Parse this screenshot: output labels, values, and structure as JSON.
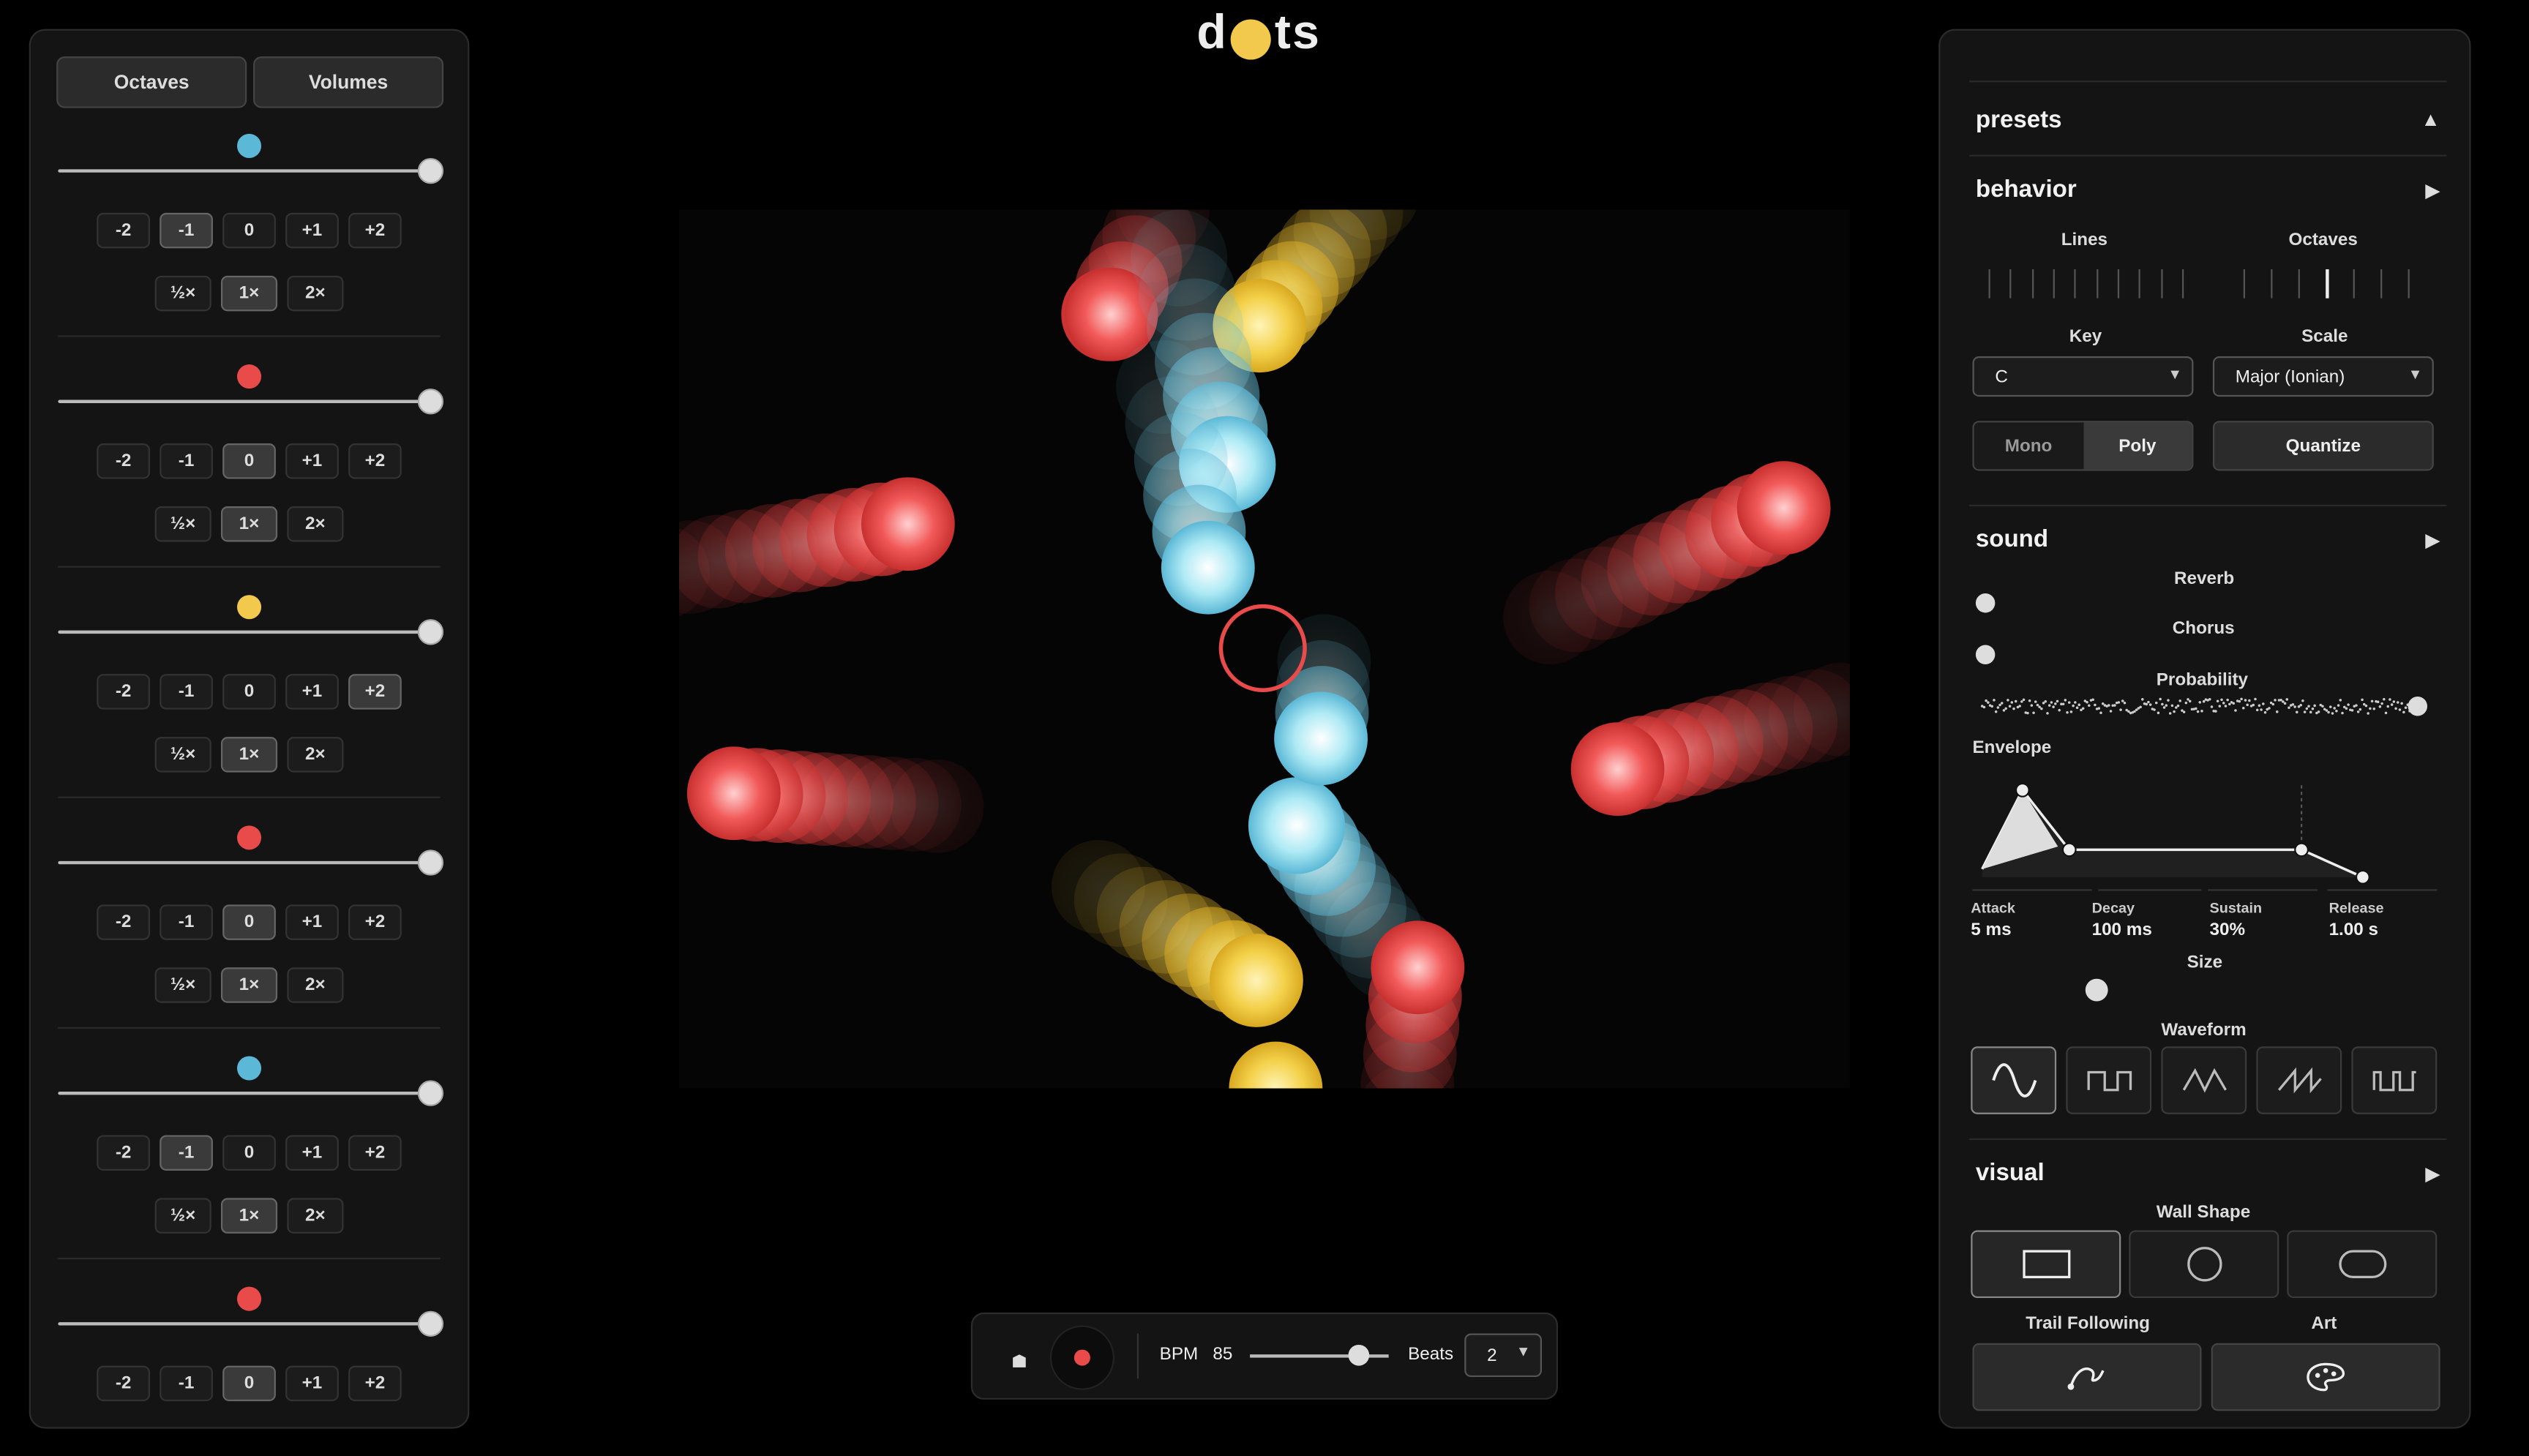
{
  "app": {
    "logo_left": "d",
    "logo_right": "ts",
    "logo_dot_color": "#f2c94c"
  },
  "left_panel": {
    "tabs": [
      "Octaves",
      "Volumes"
    ],
    "octave_buttons": [
      "-2",
      "-1",
      "0",
      "+1",
      "+2"
    ],
    "speed_buttons": [
      "½×",
      "1×",
      "2×"
    ],
    "lines": [
      {
        "color": "#5bb8d6",
        "volume": 1.0,
        "active_octave": "-1",
        "active_speed": "1×"
      },
      {
        "color": "#e94b4b",
        "volume": 1.0,
        "active_octave": "0",
        "active_speed": "1×"
      },
      {
        "color": "#f2c94c",
        "volume": 1.0,
        "active_octave": "+2",
        "active_speed": "1×"
      },
      {
        "color": "#e94b4b",
        "volume": 1.0,
        "active_octave": "0",
        "active_speed": "1×"
      },
      {
        "color": "#5bb8d6",
        "volume": 1.0,
        "active_octave": "-1",
        "active_speed": "1×"
      },
      {
        "color": "#e94b4b",
        "volume": 1.0,
        "active_octave": "0",
        "active_speed": null
      }
    ]
  },
  "transport": {
    "stop_icon": "stop-icon",
    "record_icon": "record-icon",
    "record_color": "#e94b4b",
    "bpm_label": "BPM",
    "bpm_value": "85",
    "bpm_slider_fraction": 0.78,
    "beats_label": "Beats",
    "beats_value": "2"
  },
  "right_panel": {
    "presets": {
      "title": "presets",
      "arrow": "▲"
    },
    "behavior": {
      "title": "behavior",
      "arrow": "▶",
      "lines_label": "Lines",
      "octaves_label": "Octaves",
      "key_label": "Key",
      "key_value": "C",
      "scale_label": "Scale",
      "scale_value": "Major (Ionian)",
      "mono_label": "Mono",
      "poly_label": "Poly",
      "mode_selected": "Poly",
      "quantize_label": "Quantize"
    },
    "sound": {
      "title": "sound",
      "arrow": "▶",
      "reverb_label": "Reverb",
      "reverb_fraction": 0,
      "chorus_label": "Chorus",
      "chorus_fraction": 0,
      "probability_label": "Probability",
      "probability_fraction": 1,
      "envelope_label": "Envelope",
      "attack_label": "Attack",
      "attack_value": "5 ms",
      "decay_label": "Decay",
      "decay_value": "100 ms",
      "sustain_label": "Sustain",
      "sustain_value": "30%",
      "release_label": "Release",
      "release_value": "1.00 s",
      "size_label": "Size",
      "size_fraction": 0.25,
      "waveform_label": "Waveform",
      "waveforms": [
        "sine-wave-icon",
        "square-wave-icon",
        "triangle-wave-icon",
        "sawtooth-wave-icon",
        "pulse-wave-icon"
      ],
      "waveform_selected": "sine-wave-icon"
    },
    "visual": {
      "title": "visual",
      "arrow": "▶",
      "wall_shape_label": "Wall Shape",
      "wall_shapes": [
        "rectangle-shape-icon",
        "circle-shape-icon",
        "rounded-shape-icon"
      ],
      "wall_shape_selected": "rectangle-shape-icon",
      "trail_following_label": "Trail Following",
      "art_label": "Art"
    }
  }
}
